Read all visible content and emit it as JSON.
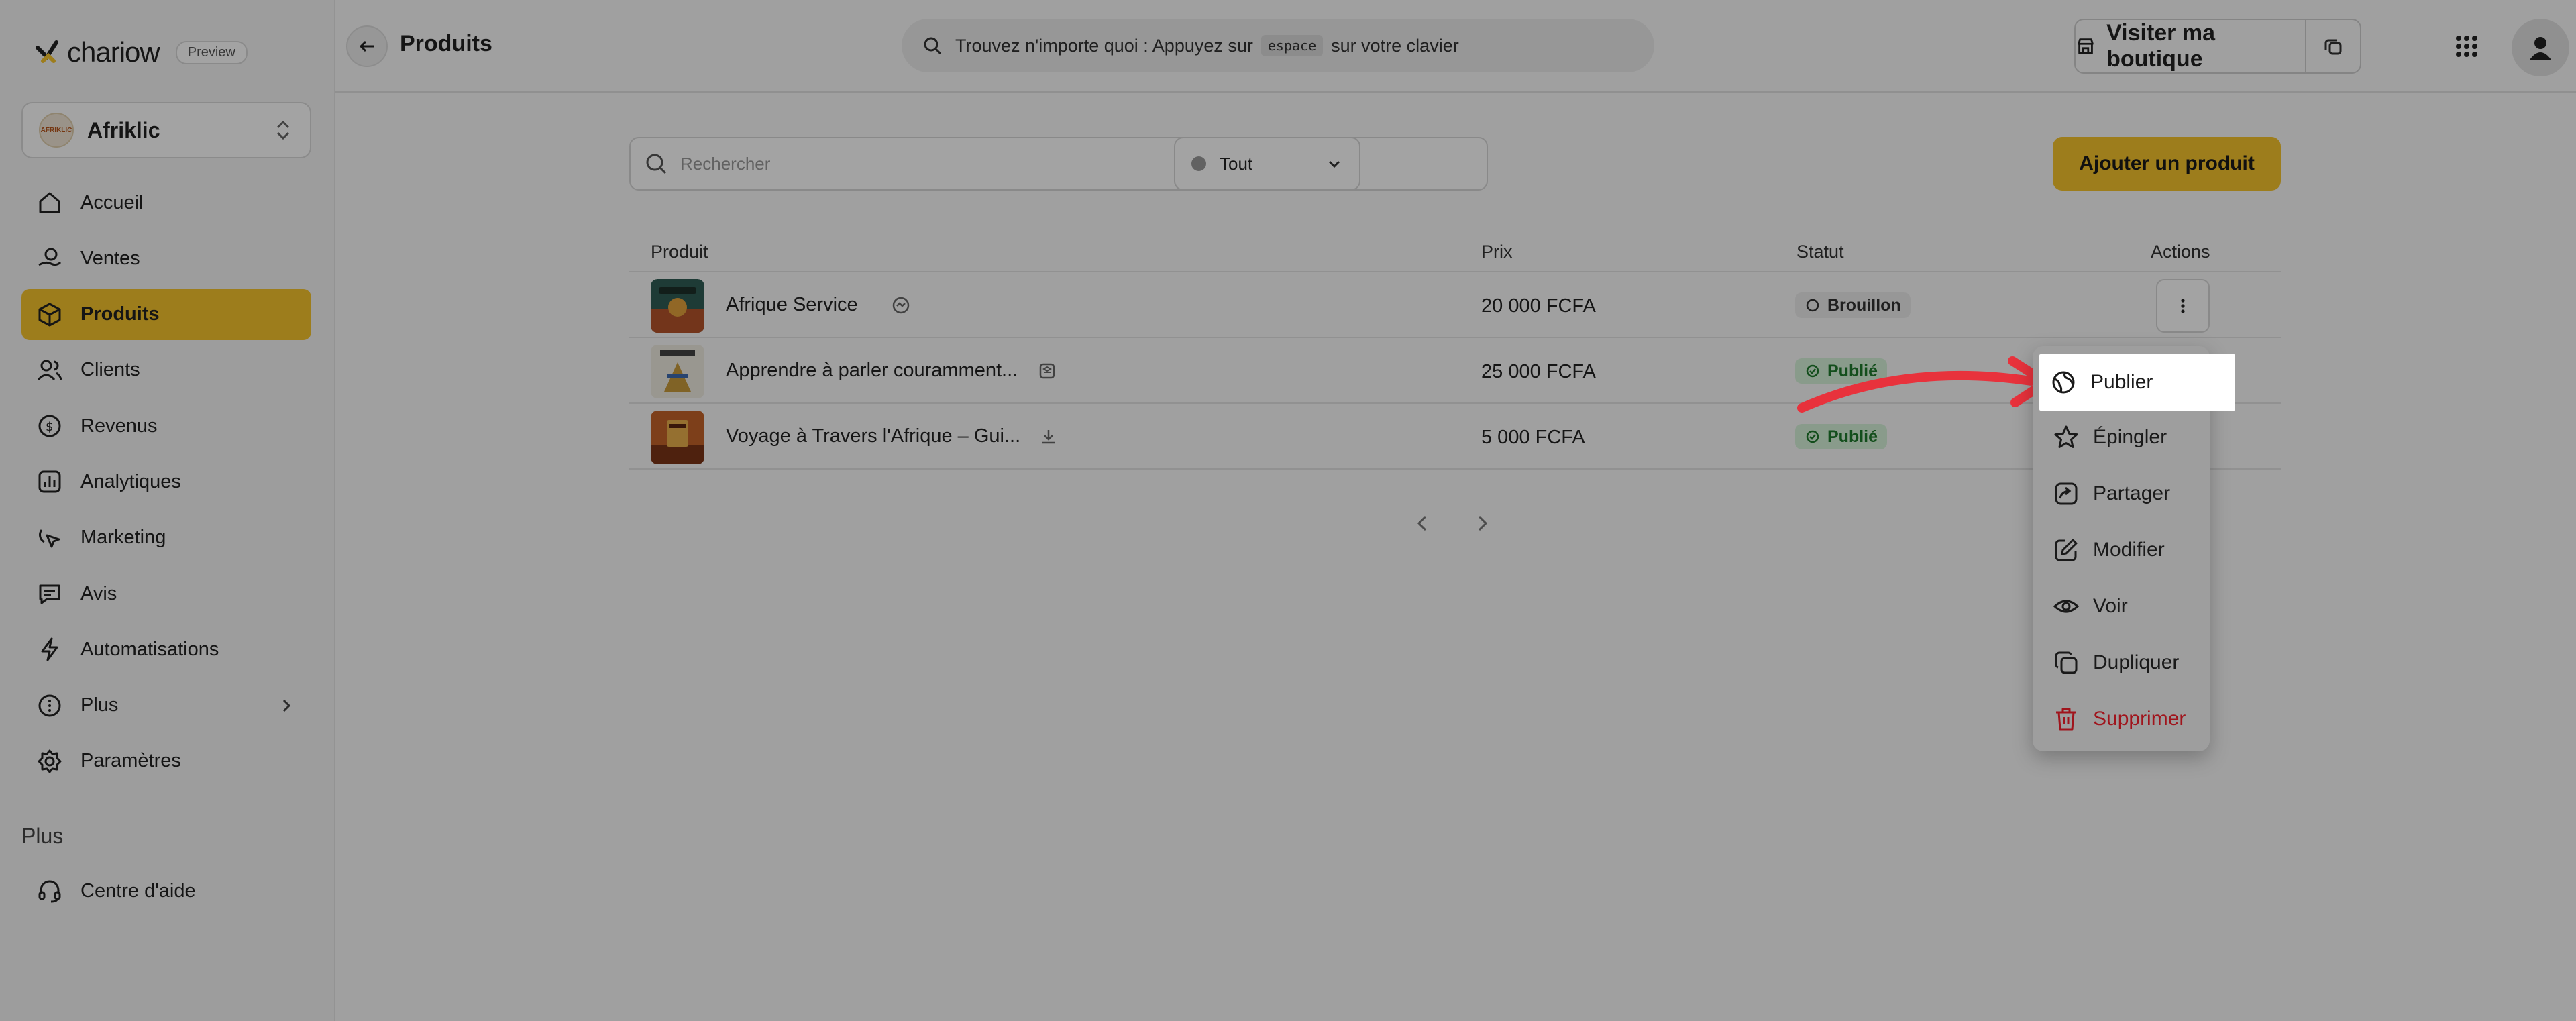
{
  "brand": {
    "name": "chariow",
    "badge": "Preview"
  },
  "store": {
    "name": "Afriklic",
    "avatar_text": "AFRIKLIC"
  },
  "sidebar": {
    "items": [
      {
        "label": "Accueil",
        "icon": "home-icon",
        "active": false
      },
      {
        "label": "Ventes",
        "icon": "sales-icon",
        "active": false
      },
      {
        "label": "Produits",
        "icon": "box-icon",
        "active": true
      },
      {
        "label": "Clients",
        "icon": "users-icon",
        "active": false
      },
      {
        "label": "Revenus",
        "icon": "revenue-icon",
        "active": false
      },
      {
        "label": "Analytiques",
        "icon": "chart-icon",
        "active": false
      },
      {
        "label": "Marketing",
        "icon": "cursor-icon",
        "active": false
      },
      {
        "label": "Avis",
        "icon": "review-icon",
        "active": false
      },
      {
        "label": "Automatisations",
        "icon": "bolt-icon",
        "active": false
      },
      {
        "label": "Plus",
        "icon": "more-icon",
        "active": false
      },
      {
        "label": "Paramètres",
        "icon": "gear-icon",
        "active": false
      }
    ],
    "section_label": "Plus",
    "help_label": "Centre d'aide"
  },
  "topbar": {
    "title": "Produits",
    "search_before": "Trouvez n'importe quoi : Appuyez sur",
    "search_key": "espace",
    "search_after": "sur votre clavier",
    "visit_label": "Visiter ma boutique"
  },
  "toolbar": {
    "search_placeholder": "Rechercher",
    "filter_label": "Tout",
    "add_label": "Ajouter un produit"
  },
  "table": {
    "headers": {
      "product": "Produit",
      "price": "Prix",
      "status": "Statut",
      "actions": "Actions"
    },
    "rows": [
      {
        "name": "Afrique Service",
        "type_icon": "service-icon",
        "price": "20 000 FCFA",
        "status": "Brouillon",
        "status_kind": "draft"
      },
      {
        "name": "Apprendre à parler couramment...",
        "type_icon": "course-icon",
        "price": "25 000 FCFA",
        "status": "Publié",
        "status_kind": "published"
      },
      {
        "name": "Voyage à Travers l'Afrique – Gui...",
        "type_icon": "download-icon",
        "price": "5 000 FCFA",
        "status": "Publié",
        "status_kind": "published"
      }
    ]
  },
  "menu": {
    "items": [
      {
        "label": "Publier",
        "icon": "globe-icon",
        "highlighted": true
      },
      {
        "label": "Épingler",
        "icon": "star-icon"
      },
      {
        "label": "Partager",
        "icon": "share-icon"
      },
      {
        "label": "Modifier",
        "icon": "edit-icon"
      },
      {
        "label": "Voir",
        "icon": "eye-icon"
      },
      {
        "label": "Dupliquer",
        "icon": "duplicate-icon"
      },
      {
        "label": "Supprimer",
        "icon": "trash-icon",
        "danger": true
      }
    ]
  },
  "colors": {
    "accent": "#f6c42c",
    "danger": "#a0141c",
    "published": "#1e7a2c",
    "arrow": "#e8323c"
  }
}
